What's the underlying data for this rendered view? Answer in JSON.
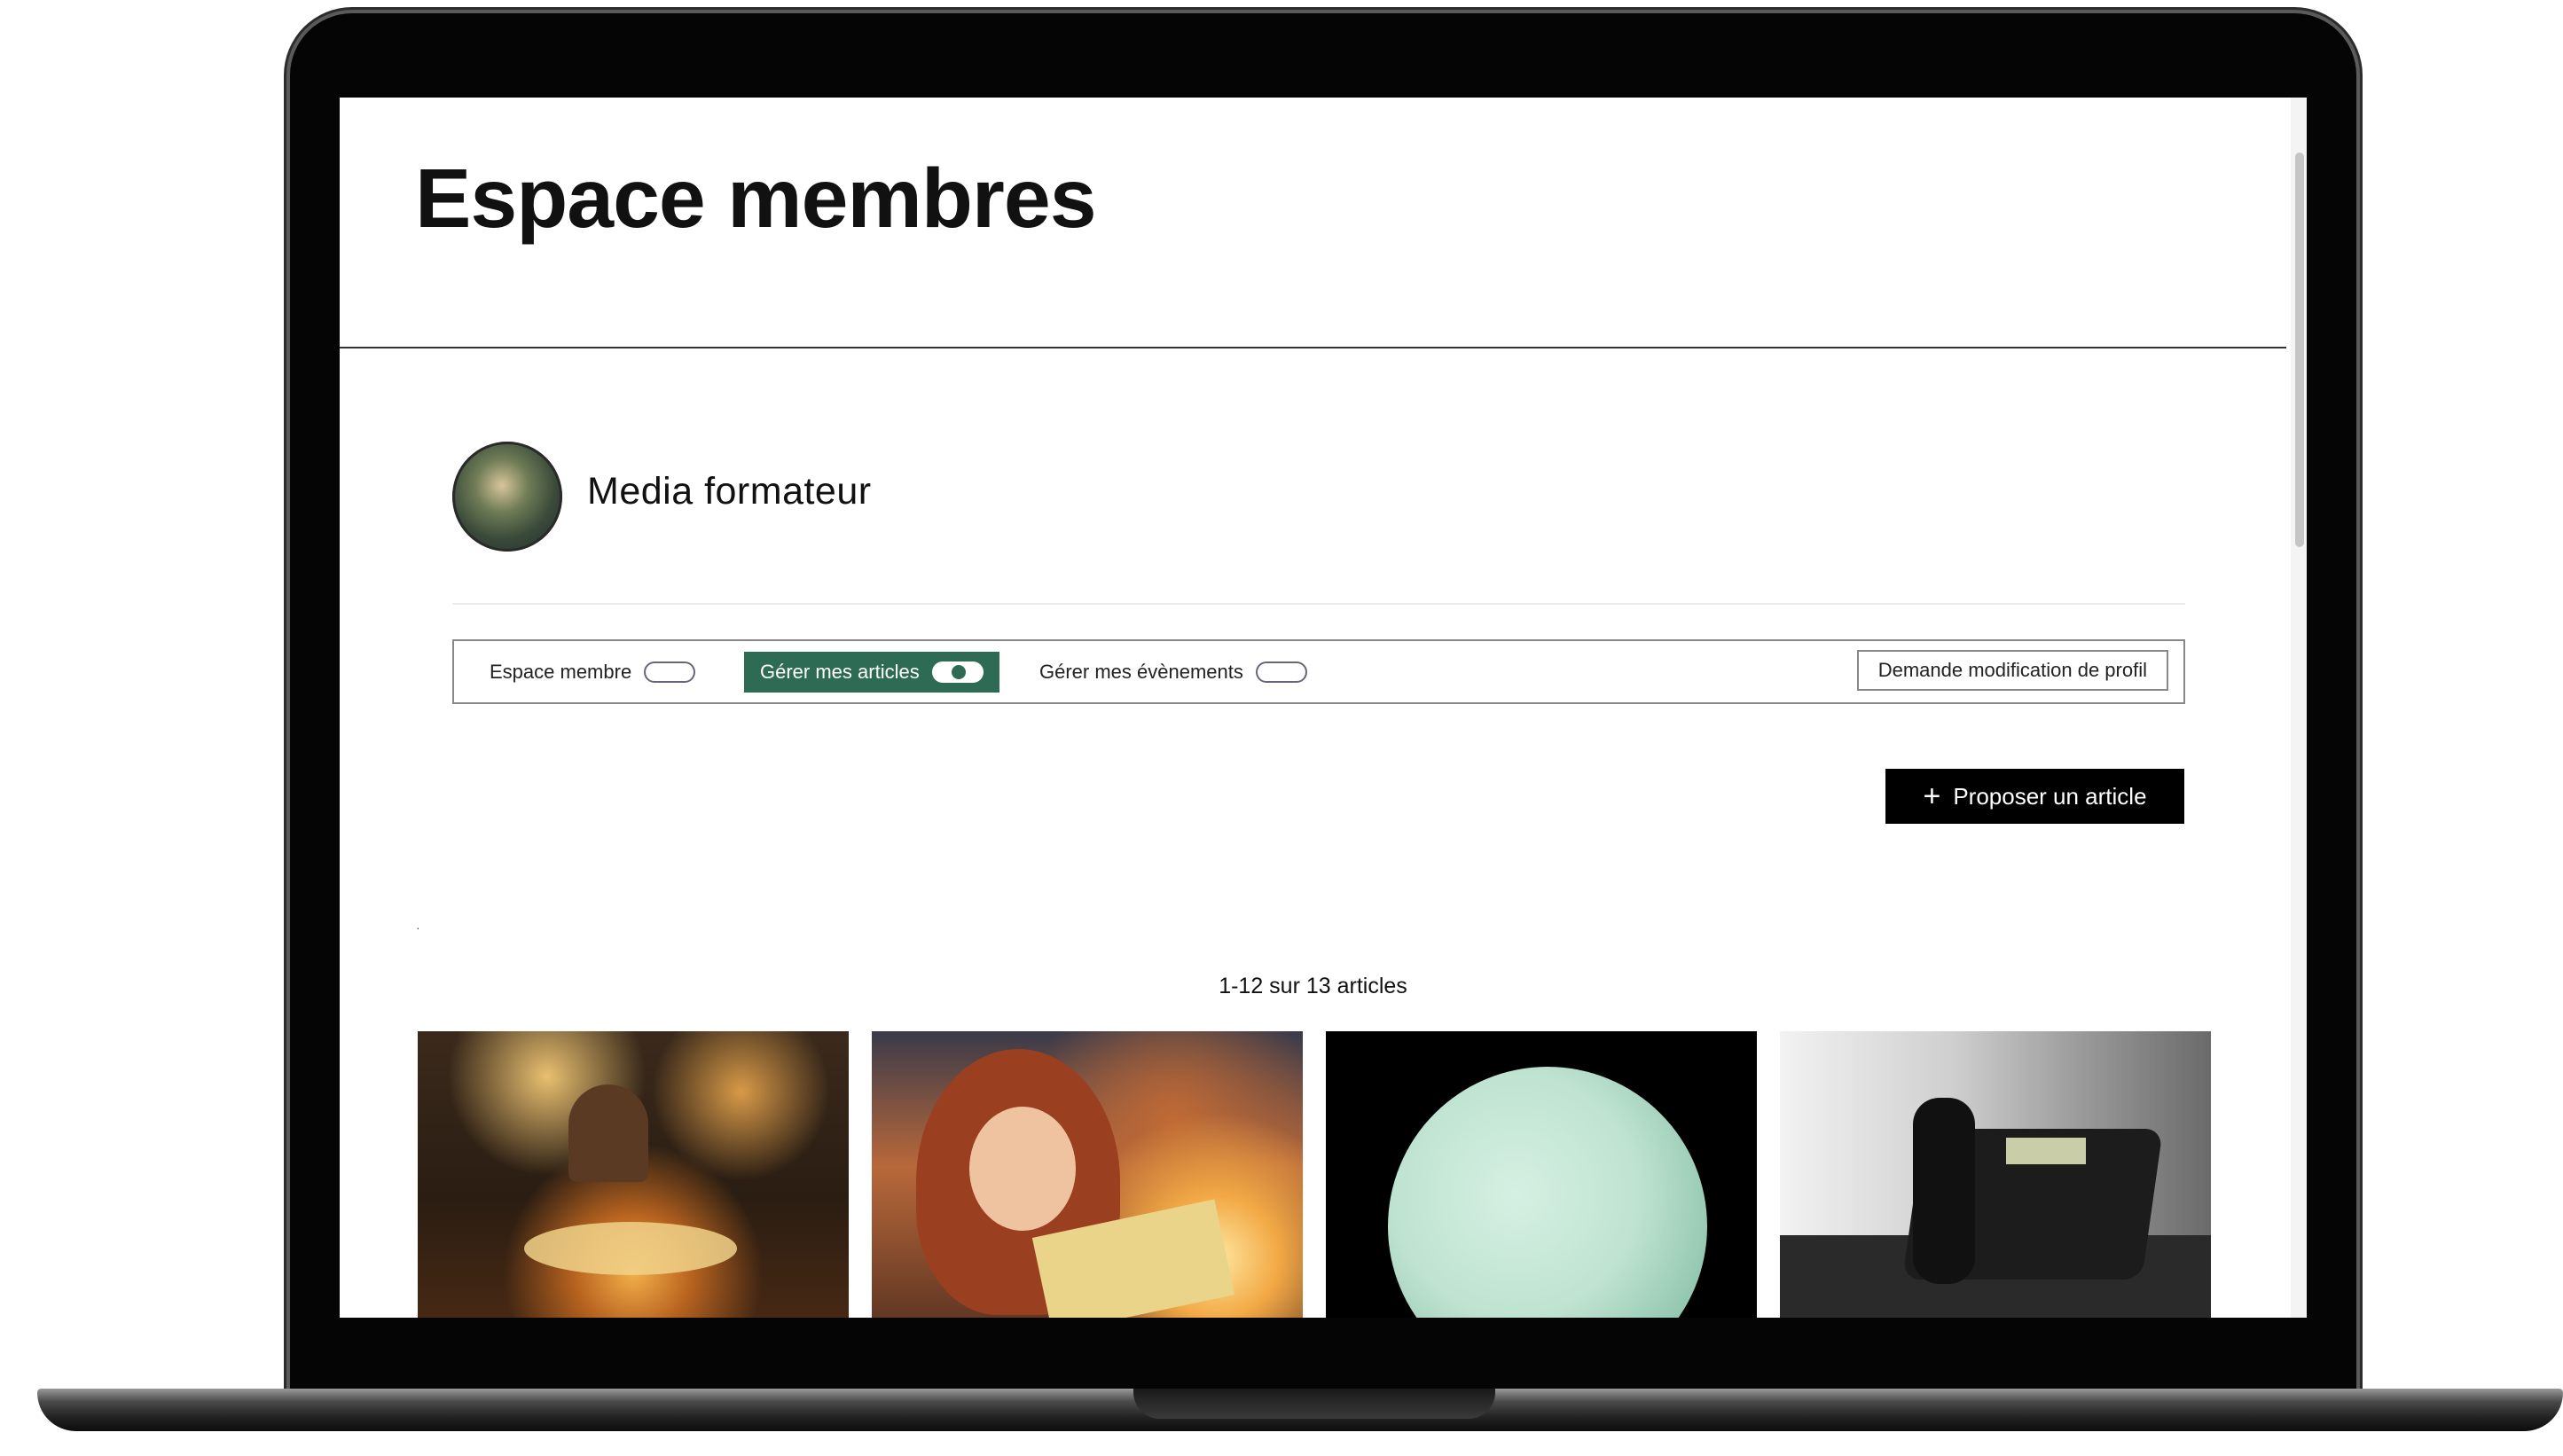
{
  "page": {
    "title": "Espace membres"
  },
  "profile": {
    "name": "Media formateur"
  },
  "tabs": [
    {
      "label": "Espace membre",
      "active": false
    },
    {
      "label": "Gérer mes articles",
      "active": true
    },
    {
      "label": "Gérer mes évènements",
      "active": false
    }
  ],
  "actions": {
    "profile_request_label": "Demande modification de profil",
    "propose_article_label": "Proposer un article",
    "propose_article_icon": "plus-icon"
  },
  "stray_mark": "·",
  "results": {
    "count_label": "1-12 sur 13 articles"
  },
  "colors": {
    "accent": "#2e6b55",
    "primary_button": "#000000"
  },
  "articles": [
    {
      "image": "children-reading-candlelight"
    },
    {
      "image": "girl-with-glowing-book"
    },
    {
      "image": "planet"
    },
    {
      "image": "office-desk-phone"
    }
  ]
}
